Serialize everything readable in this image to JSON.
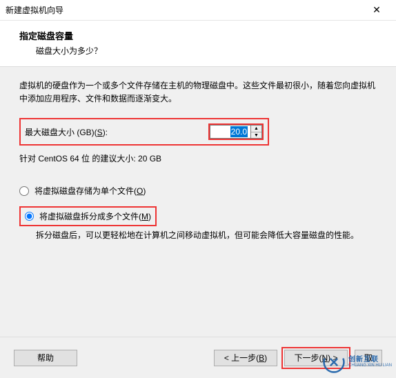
{
  "title": "新建虚拟机向导",
  "close_icon": "✕",
  "header": {
    "title": "指定磁盘容量",
    "subtitle": "磁盘大小为多少？"
  },
  "desc": "虚拟机的硬盘作为一个或多个文件存储在主机的物理磁盘中。这些文件最初很小，随着您向虚拟机中添加应用程序、文件和数据而逐渐变大。",
  "size": {
    "label_pre": "最大磁盘大小 (GB)(",
    "label_key": "S",
    "label_post": "):",
    "value": "20.0"
  },
  "recommend": "针对 CentOS 64 位 的建议大小: 20 GB",
  "radio": {
    "single_pre": "将虚拟磁盘存储为单个文件(",
    "single_key": "O",
    "single_post": ")",
    "multi_pre": "将虚拟磁盘拆分成多个文件(",
    "multi_key": "M",
    "multi_post": ")",
    "multi_desc": "拆分磁盘后，可以更轻松地在计算机之间移动虚拟机，但可能会降低大容量磁盘的性能。"
  },
  "buttons": {
    "help": "帮助",
    "back_pre": "< 上一步(",
    "back_key": "B",
    "back_post": ")",
    "next_pre": "下一步(",
    "next_key": "N",
    "next_post": ") >",
    "cancel": "取"
  },
  "watermark": {
    "line1": "创新互联",
    "line2": "CHUANG XIN HU LIAN"
  }
}
